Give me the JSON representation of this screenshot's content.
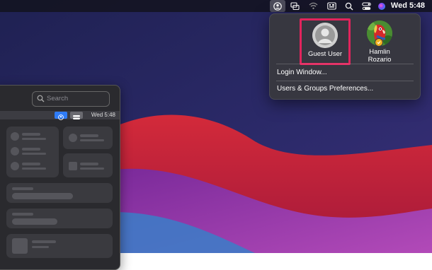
{
  "menubar": {
    "icons": [
      "user-switch-icon",
      "screen-mirror-icon",
      "wifi-icon",
      "keyboard-viewer-icon",
      "search-icon",
      "control-center-icon",
      "siri-icon"
    ],
    "clock": "Wed 5:48"
  },
  "user_menu": {
    "users": [
      {
        "name": "Guest User",
        "icon": "guest-avatar-icon",
        "highlighted": true
      },
      {
        "name": "Hamlin\nRozario",
        "icon": "parrot-avatar-icon",
        "status": "online"
      }
    ],
    "items": [
      {
        "label": "Login Window..."
      },
      {
        "label": "Users & Groups Preferences..."
      }
    ],
    "highlight_color": "#e2245c"
  },
  "preview_window": {
    "search_placeholder": "Search",
    "clock": "Wed 5:48"
  }
}
